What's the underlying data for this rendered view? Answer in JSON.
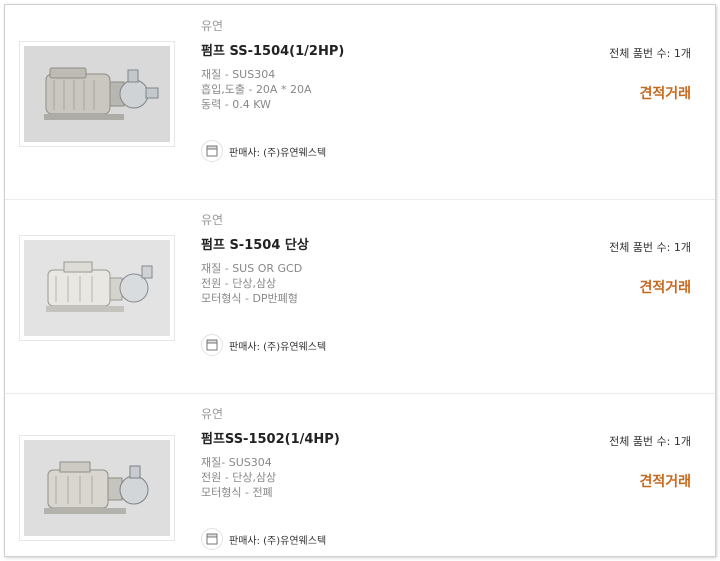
{
  "products": [
    {
      "maker": "유연",
      "title": "펌프 SS-1504(1/2HP)",
      "specs": [
        "재질 - SUS304",
        "흡입,도출 - 20A * 20A",
        "동력 - 0.4 KW"
      ],
      "seller": "판매사: (주)유연웨스텍",
      "count": "전체 품번 수: 1개",
      "quote": "견적거래"
    },
    {
      "maker": "유연",
      "title": "펌프 S-1504 단상",
      "specs": [
        "재질 - SUS OR GCD",
        "전원 - 단상,삼상",
        "모터형식 - DP반폐형"
      ],
      "seller": "판매사: (주)유연웨스텍",
      "count": "전체 품번 수: 1개",
      "quote": "견적거래"
    },
    {
      "maker": "유연",
      "title": "펌프SS-1502(1/4HP)",
      "specs": [
        "재질- SUS304",
        "전원 - 단상,삼상",
        "모터형식 - 전폐"
      ],
      "seller": "판매사: (주)유연웨스텍",
      "count": "전체 품번 수: 1개",
      "quote": "견적거래"
    }
  ],
  "colors": {
    "accent": "#c46a1f",
    "maker": "#999999",
    "spec": "#888888"
  },
  "icons": {
    "seller": "store-icon",
    "product": "pump-image"
  }
}
